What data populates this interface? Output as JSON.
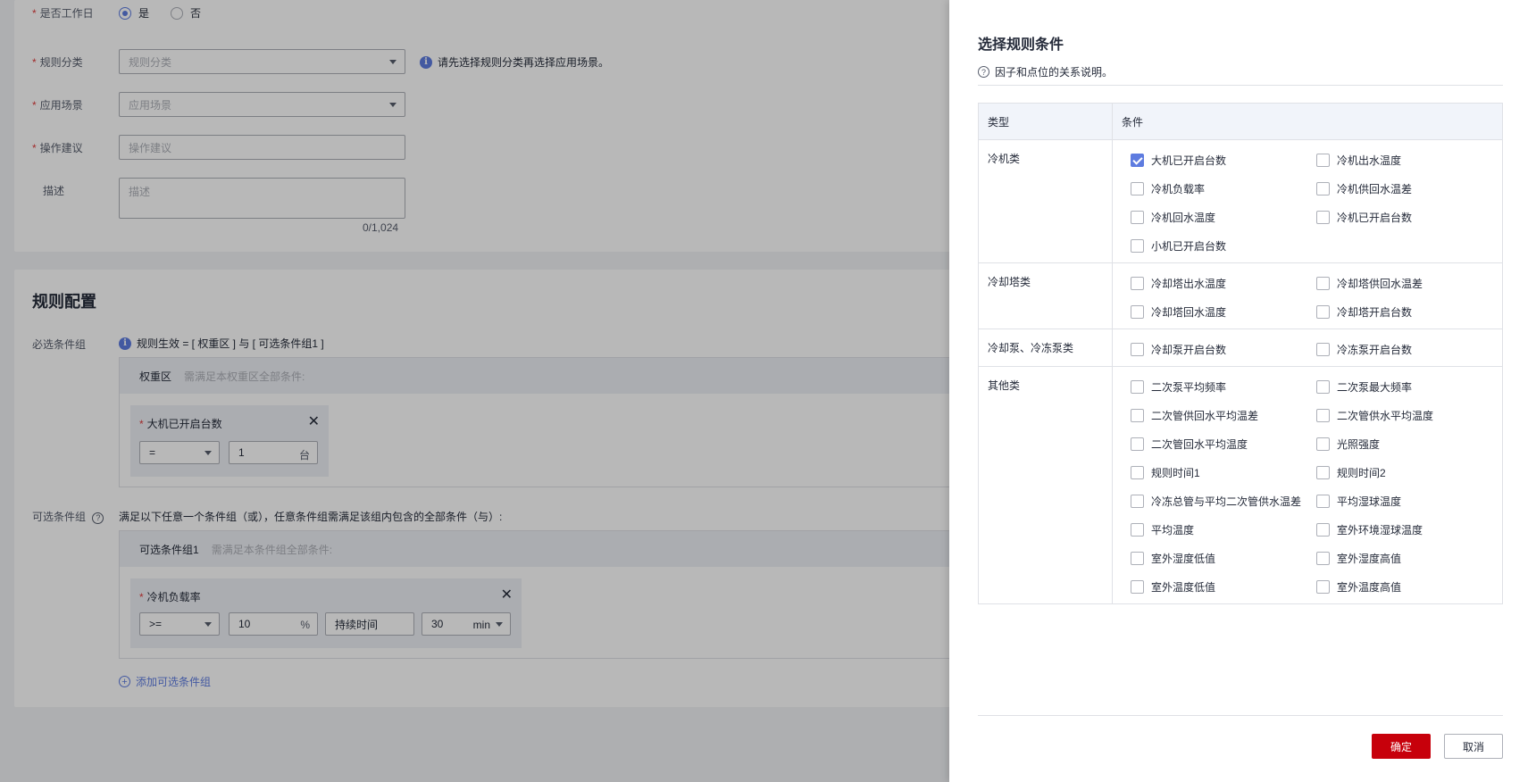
{
  "form": {
    "workday": {
      "label": "是否工作日",
      "options": [
        "是",
        "否"
      ],
      "selected": "是"
    },
    "category": {
      "label": "规则分类",
      "placeholder": "规则分类",
      "hint": "请先选择规则分类再选择应用场景。"
    },
    "scene": {
      "label": "应用场景",
      "placeholder": "应用场景"
    },
    "suggestion": {
      "label": "操作建议",
      "placeholder": "操作建议"
    },
    "description": {
      "label": "描述",
      "placeholder": "描述",
      "counter": "0/1,024"
    }
  },
  "config": {
    "title": "规则配置",
    "required": {
      "label": "必选条件组",
      "formula": "规则生效 = [ 权重区 ] 与 [ 可选条件组1 ]",
      "zone_title": "权重区",
      "zone_hint": "需满足本权重区全部条件:",
      "condition": {
        "name": "大机已开启台数",
        "operator": "=",
        "value": "1",
        "unit": "台"
      }
    },
    "optional": {
      "label": "可选条件组",
      "hint": "满足以下任意一个条件组（或），任意条件组需满足该组内包含的全部条件（与）:",
      "group_title": "可选条件组1",
      "group_hint": "需满足本条件组全部条件:",
      "condition": {
        "name": "冷机负载率",
        "operator": ">=",
        "value": "10",
        "unit": "%",
        "duration_label": "持续时间",
        "duration": "30",
        "duration_unit": "min"
      },
      "add_label": "添加可选条件组"
    }
  },
  "drawer": {
    "title": "选择规则条件",
    "help": "因子和点位的关系说明。",
    "table_headers": [
      "类型",
      "条件"
    ],
    "rows": [
      {
        "type": "冷机类",
        "items": [
          {
            "label": "大机已开启台数",
            "checked": true
          },
          {
            "label": "冷机出水温度",
            "checked": false
          },
          {
            "label": "冷机负载率",
            "checked": false
          },
          {
            "label": "冷机供回水温差",
            "checked": false
          },
          {
            "label": "冷机回水温度",
            "checked": false
          },
          {
            "label": "冷机已开启台数",
            "checked": false
          },
          {
            "label": "小机已开启台数",
            "checked": false
          }
        ]
      },
      {
        "type": "冷却塔类",
        "items": [
          {
            "label": "冷却塔出水温度",
            "checked": false
          },
          {
            "label": "冷却塔供回水温差",
            "checked": false
          },
          {
            "label": "冷却塔回水温度",
            "checked": false
          },
          {
            "label": "冷却塔开启台数",
            "checked": false
          }
        ]
      },
      {
        "type": "冷却泵、冷冻泵类",
        "items": [
          {
            "label": "冷却泵开启台数",
            "checked": false
          },
          {
            "label": "冷冻泵开启台数",
            "checked": false
          }
        ]
      },
      {
        "type": "其他类",
        "items": [
          {
            "label": "二次泵平均频率",
            "checked": false
          },
          {
            "label": "二次泵最大频率",
            "checked": false
          },
          {
            "label": "二次管供回水平均温差",
            "checked": false
          },
          {
            "label": "二次管供水平均温度",
            "checked": false
          },
          {
            "label": "二次管回水平均温度",
            "checked": false
          },
          {
            "label": "光照强度",
            "checked": false
          },
          {
            "label": "规则时间1",
            "checked": false
          },
          {
            "label": "规则时间2",
            "checked": false
          },
          {
            "label": "冷冻总管与平均二次管供水温差",
            "checked": false
          },
          {
            "label": "平均湿球温度",
            "checked": false
          },
          {
            "label": "平均温度",
            "checked": false
          },
          {
            "label": "室外环境湿球温度",
            "checked": false
          },
          {
            "label": "室外湿度低值",
            "checked": false
          },
          {
            "label": "室外湿度高值",
            "checked": false
          },
          {
            "label": "室外温度低值",
            "checked": false
          },
          {
            "label": "室外温度高值",
            "checked": false
          }
        ]
      }
    ],
    "ok_label": "确定",
    "cancel_label": "取消"
  },
  "colors": {
    "primary": "#5e7ce0",
    "danger": "#c7000b",
    "border": "#dfe1e6"
  }
}
